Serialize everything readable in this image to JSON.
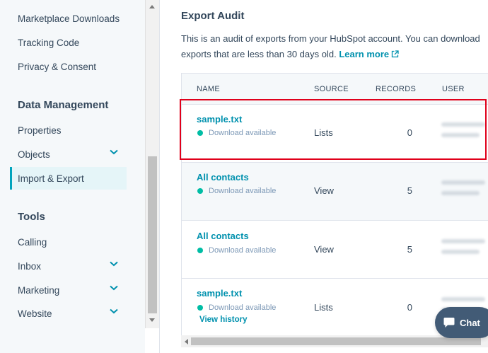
{
  "sidebar": {
    "items_top": [
      {
        "label": "Marketplace Downloads"
      },
      {
        "label": "Tracking Code"
      },
      {
        "label": "Privacy & Consent"
      }
    ],
    "data_management": {
      "heading": "Data Management",
      "items": [
        {
          "label": "Properties"
        },
        {
          "label": "Objects"
        },
        {
          "label": "Import & Export"
        }
      ]
    },
    "tools": {
      "heading": "Tools",
      "items": [
        {
          "label": "Calling"
        },
        {
          "label": "Inbox"
        },
        {
          "label": "Marketing"
        },
        {
          "label": "Website"
        }
      ]
    }
  },
  "main": {
    "title": "Export Audit",
    "desc_line1": "This is an audit of exports from your HubSpot account. You can download",
    "desc_line2": "exports that are less than 30 days old.",
    "learn_more": "Learn more",
    "table": {
      "headers": [
        "NAME",
        "SOURCE",
        "RECORDS",
        "USER"
      ],
      "rows": [
        {
          "name": "sample.txt",
          "status": "Download available",
          "source": "Lists",
          "records": "0"
        },
        {
          "name": "All contacts",
          "status": "Download available",
          "source": "View",
          "records": "5"
        },
        {
          "name": "All contacts",
          "status": "Download available",
          "source": "View",
          "records": "5"
        },
        {
          "name": "sample.txt",
          "status": "Download available",
          "source": "Lists",
          "records": "0",
          "extra_link": "View history"
        }
      ]
    }
  },
  "chat": {
    "label": "Chat"
  },
  "colors": {
    "accent": "#0091ae",
    "status": "#00bda5",
    "highlight": "#e0001b"
  }
}
